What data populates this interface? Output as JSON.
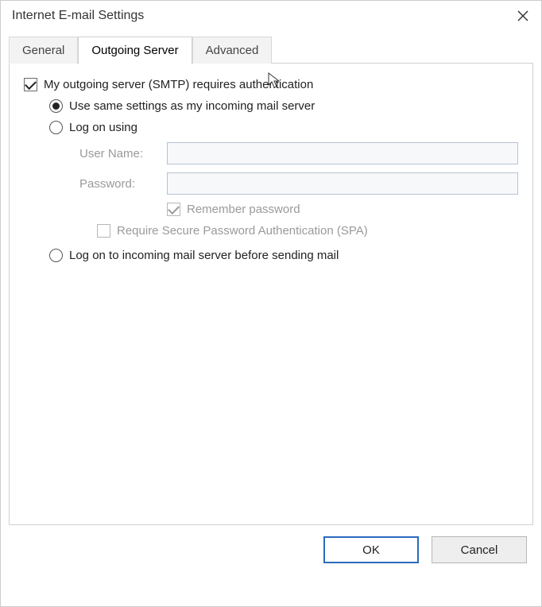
{
  "window": {
    "title": "Internet E-mail Settings"
  },
  "tabs": {
    "general": "General",
    "outgoing": "Outgoing Server",
    "advanced": "Advanced"
  },
  "form": {
    "requires_auth_label": "My outgoing server (SMTP) requires authentication",
    "same_settings_label": "Use same settings as my incoming mail server",
    "log_on_using_label": "Log on using",
    "username_label": "User Name:",
    "password_label": "Password:",
    "username_value": "",
    "password_value": "",
    "remember_pw_label": "Remember password",
    "require_spa_label": "Require Secure Password Authentication (SPA)",
    "log_on_incoming_label": "Log on to incoming mail server before sending mail"
  },
  "buttons": {
    "ok": "OK",
    "cancel": "Cancel"
  }
}
